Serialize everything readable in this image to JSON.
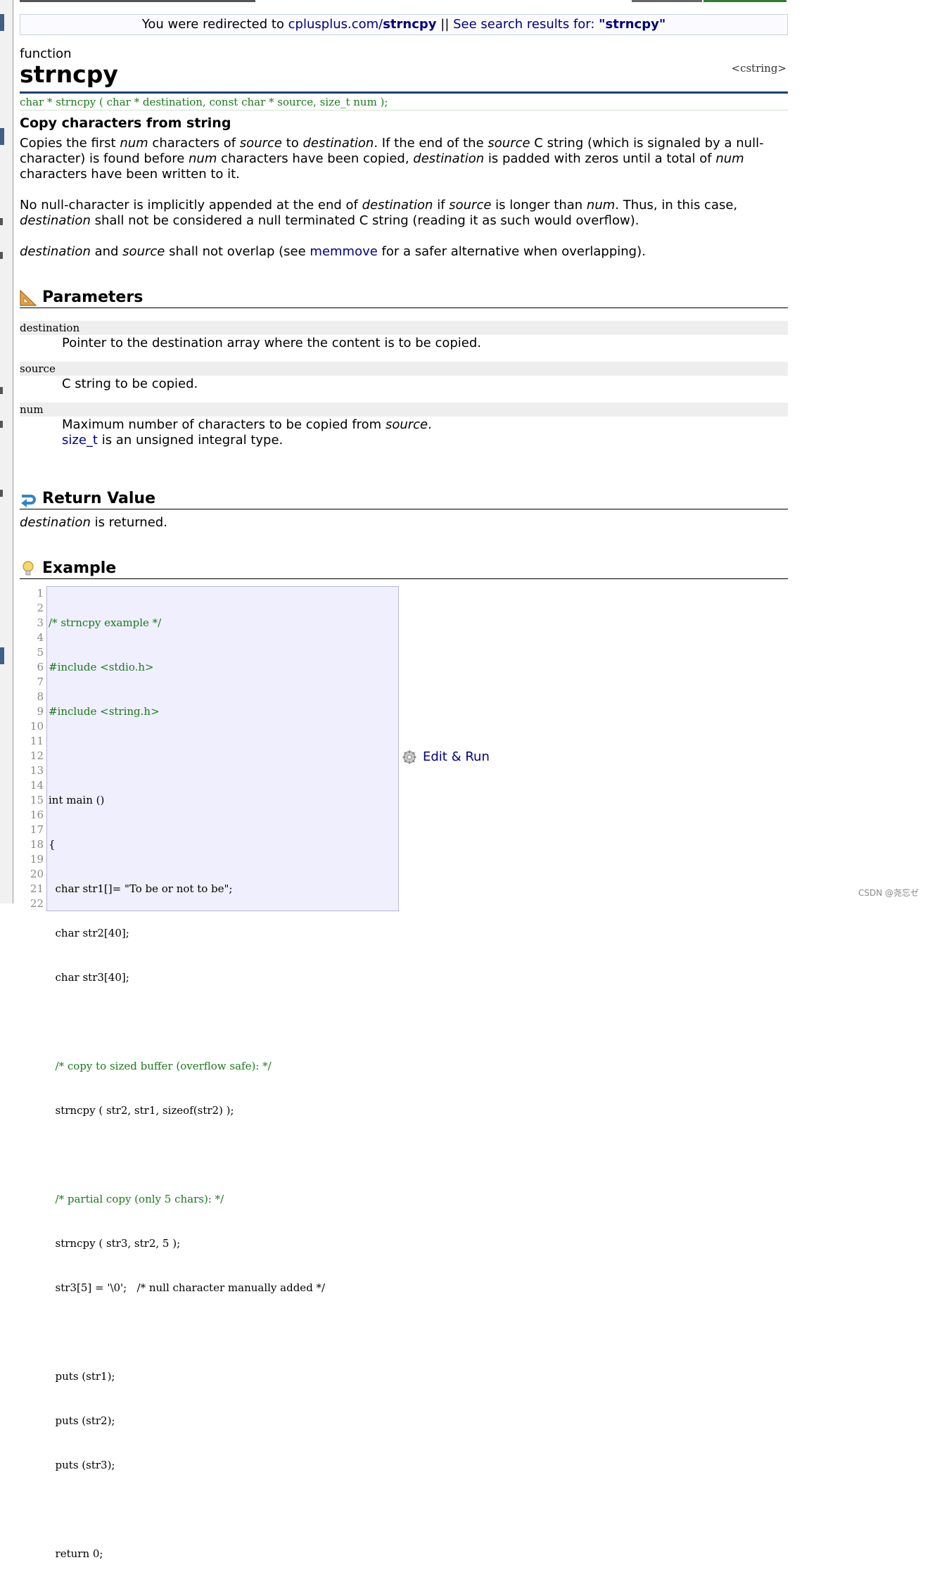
{
  "redirect": {
    "prefix": "You were redirected to ",
    "site": "cplusplus.com/",
    "page": "strncpy",
    "separator": " || ",
    "search_text": "See search results for: ",
    "search_query": "\"strncpy\""
  },
  "header": {
    "kind": "function",
    "title": "strncpy",
    "header_file": "<cstring>"
  },
  "prototype": "char * strncpy ( char * destination, const char * source, size_t num );",
  "summary": "Copy characters from string",
  "description": {
    "p1": {
      "t1": "Copies the first ",
      "i1": "num",
      "t2": " characters of ",
      "i2": "source",
      "t3": " to ",
      "i3": "destination",
      "t4": ". If the end of the ",
      "i4": "source",
      "t5": " C string (which is signaled by a null-character) is found before ",
      "i5": "num",
      "t6": " characters have been copied, ",
      "i6": "destination",
      "t7": " is padded with zeros until a total of ",
      "i7": "num",
      "t8": " characters have been written to it."
    },
    "p2": {
      "t1": "No null-character is implicitly appended at the end of ",
      "i1": "destination",
      "t2": " if ",
      "i2": "source",
      "t3": " is longer than ",
      "i3": "num",
      "t4": ". Thus, in this case, ",
      "i4": "destination",
      "t5": " shall not be considered a null terminated C string (reading it as such would overflow)."
    },
    "p3": {
      "i1": "destination",
      "t1": " and ",
      "i2": "source",
      "t2": " shall not overlap (see ",
      "link": "memmove",
      "t3": " for a safer alternative when overlapping)."
    }
  },
  "parameters": {
    "heading": "Parameters",
    "items": [
      {
        "name": "destination",
        "desc": "Pointer to the destination array where the content is to be copied."
      },
      {
        "name": "source",
        "desc": "C string to be copied."
      },
      {
        "name": "num",
        "desc_t1": "Maximum number of characters to be copied from ",
        "desc_i1": "source",
        "desc_t2": ".",
        "desc2_link": "size_t",
        "desc2_t1": " is an unsigned integral type."
      }
    ]
  },
  "return_value": {
    "heading": "Return Value",
    "i1": "destination",
    "t1": " is returned."
  },
  "example": {
    "heading": "Example",
    "line_numbers": [
      "1",
      "2",
      "3",
      "4",
      "5",
      "6",
      "7",
      "8",
      "9",
      "10",
      "11",
      "12",
      "13",
      "14",
      "15",
      "16",
      "17",
      "18",
      "19",
      "20",
      "21",
      "22"
    ],
    "code": [
      "/* strncpy example */",
      "#include <stdio.h>",
      "#include <string.h>",
      "",
      "int main ()",
      "{",
      "  char str1[]= \"To be or not to be\";",
      "  char str2[40];",
      "  char str3[40];",
      "",
      "  /* copy to sized buffer (overflow safe): */",
      "  strncpy ( str2, str1, sizeof(str2) );",
      "",
      "  /* partial copy (only 5 chars): */",
      "  strncpy ( str3, str2, 5 );",
      "  str3[5] = '\\0';   /* null character manually added */",
      "",
      "  puts (str1);",
      "  puts (str2);",
      "  puts (str3);",
      "",
      "  return 0;"
    ],
    "edit_run_label": "Edit & Run"
  },
  "watermark": "CSDN @尧忘ゼ",
  "colors": {
    "link": "#000080",
    "title_rule": "#1f3c7a",
    "prototype": "#1a7a1a",
    "code_bg": "#efeffe",
    "param_bg": "#eeeeee"
  }
}
